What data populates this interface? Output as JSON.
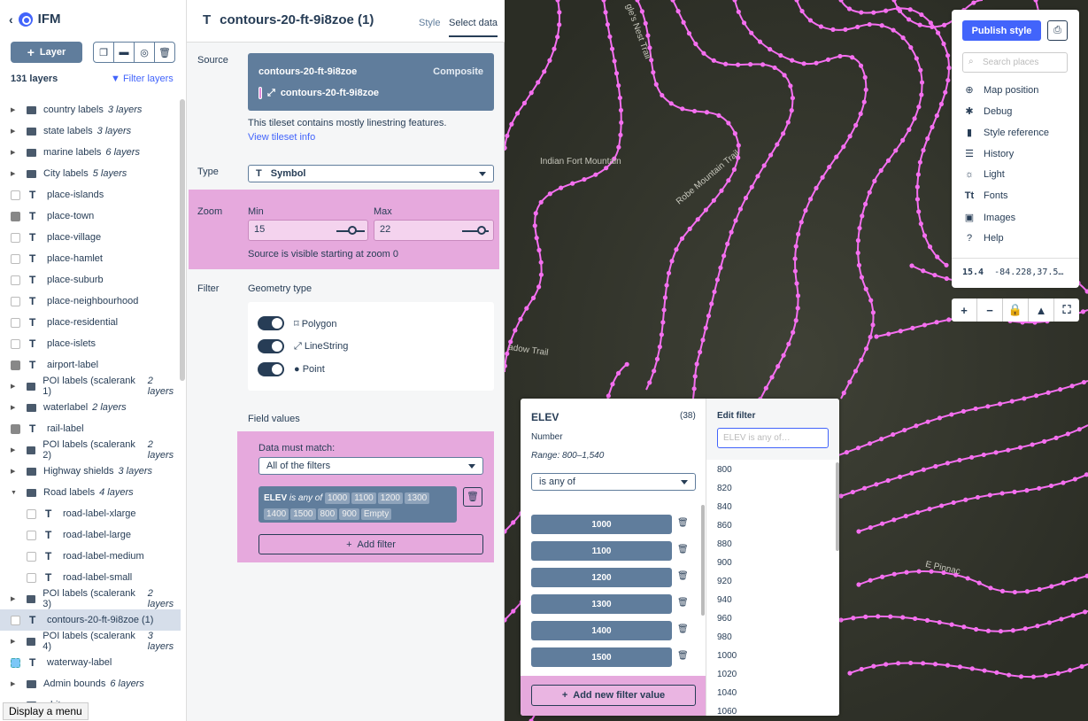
{
  "app": {
    "title": "IFM"
  },
  "sidebar": {
    "add_layer": "Layer",
    "layer_count": "131 layers",
    "filter_layers": "Filter layers",
    "items": [
      {
        "label": "country labels",
        "sub": "3 layers",
        "kind": "group"
      },
      {
        "label": "state labels",
        "sub": "3 layers",
        "kind": "group"
      },
      {
        "label": "marine labels",
        "sub": "6 layers",
        "kind": "group"
      },
      {
        "label": "City labels",
        "sub": "5 layers",
        "kind": "group"
      },
      {
        "label": "place-islands",
        "kind": "symbol"
      },
      {
        "label": "place-town",
        "kind": "symbol-img"
      },
      {
        "label": "place-village",
        "kind": "symbol"
      },
      {
        "label": "place-hamlet",
        "kind": "symbol"
      },
      {
        "label": "place-suburb",
        "kind": "symbol"
      },
      {
        "label": "place-neighbourhood",
        "kind": "symbol"
      },
      {
        "label": "place-residential",
        "kind": "symbol"
      },
      {
        "label": "place-islets",
        "kind": "symbol"
      },
      {
        "label": "airport-label",
        "kind": "symbol-img"
      },
      {
        "label": "POI labels (scalerank 1)",
        "sub": "2 layers",
        "kind": "group"
      },
      {
        "label": "waterlabel",
        "sub": "2 layers",
        "kind": "group"
      },
      {
        "label": "rail-label",
        "kind": "symbol-img"
      },
      {
        "label": "POI labels (scalerank 2)",
        "sub": "2 layers",
        "kind": "group"
      },
      {
        "label": "Highway shields",
        "sub": "3 layers",
        "kind": "group"
      },
      {
        "label": "Road labels",
        "sub": "4 layers",
        "kind": "group-open"
      },
      {
        "label": "road-label-xlarge",
        "kind": "symbol-ind"
      },
      {
        "label": "road-label-large",
        "kind": "symbol-ind"
      },
      {
        "label": "road-label-medium",
        "kind": "symbol-ind"
      },
      {
        "label": "road-label-small",
        "kind": "symbol-ind"
      },
      {
        "label": "POI labels (scalerank 3)",
        "sub": "2 layers",
        "kind": "group"
      },
      {
        "label": "contours-20-ft-9i8zoe (1)",
        "kind": "symbol-sel"
      },
      {
        "label": "POI labels (scalerank 4)",
        "sub": "3 layers",
        "kind": "group"
      },
      {
        "label": "waterway-label",
        "kind": "symbol-blue"
      },
      {
        "label": "Admin bounds",
        "sub": "6 layers",
        "kind": "group"
      },
      {
        "label": "white",
        "kind": "partial"
      }
    ],
    "tooltip": "Display a menu"
  },
  "panel": {
    "title": "contours-20-ft-9i8zoe (1)",
    "tab_style": "Style",
    "tab_select": "Select data",
    "source_label": "Source",
    "source_name": "contours-20-ft-9i8zoe",
    "source_type": "Composite",
    "source_layer": "contours-20-ft-9i8zoe",
    "source_note": "This tileset contains mostly linestring features.",
    "view_tileset": "View tileset info",
    "type_label": "Type",
    "type_value": "Symbol",
    "zoom_label": "Zoom",
    "min_label": "Min",
    "min_value": "15",
    "max_label": "Max",
    "max_value": "22",
    "zoom_note": "Source is visible starting at zoom 0",
    "filter_label": "Filter",
    "geometry_label": "Geometry type",
    "geometry": [
      "Polygon",
      "LineString",
      "Point"
    ],
    "field_values": "Field values",
    "must_match": "Data must match:",
    "match_option": "All of the filters",
    "filter_field": "ELEV",
    "filter_op": "is any of",
    "filter_values": [
      "1000",
      "1100",
      "1200",
      "1300",
      "1400",
      "1500",
      "800",
      "900",
      "Empty"
    ],
    "add_filter": "Add filter"
  },
  "map": {
    "labels": [
      "Indian Fort Mountain",
      "Robe Mountain Trail",
      "gle's Nest Trail",
      "adow Trail",
      "E Pinnac"
    ],
    "line_color": "#f56ff0"
  },
  "right": {
    "publish": "Publish style",
    "search_placeholder": "Search places",
    "items": [
      "Map position",
      "Debug",
      "Style reference",
      "History",
      "Light",
      "Fonts",
      "Images",
      "Help"
    ],
    "zoom": "15.4",
    "coords": "-84.228,37.5…"
  },
  "elev": {
    "field": "ELEV",
    "count": "(38)",
    "type": "Number",
    "range": "Range: 800–1,540",
    "op": "is any of",
    "values": [
      "1000",
      "1100",
      "1200",
      "1300",
      "1400",
      "1500"
    ],
    "add_value": "Add new filter value",
    "edit_label": "Edit filter",
    "edit_placeholder": "ELEV is any of…",
    "list": [
      "800",
      "820",
      "840",
      "860",
      "880",
      "900",
      "920",
      "940",
      "960",
      "980",
      "1000",
      "1020",
      "1040",
      "1060"
    ]
  }
}
